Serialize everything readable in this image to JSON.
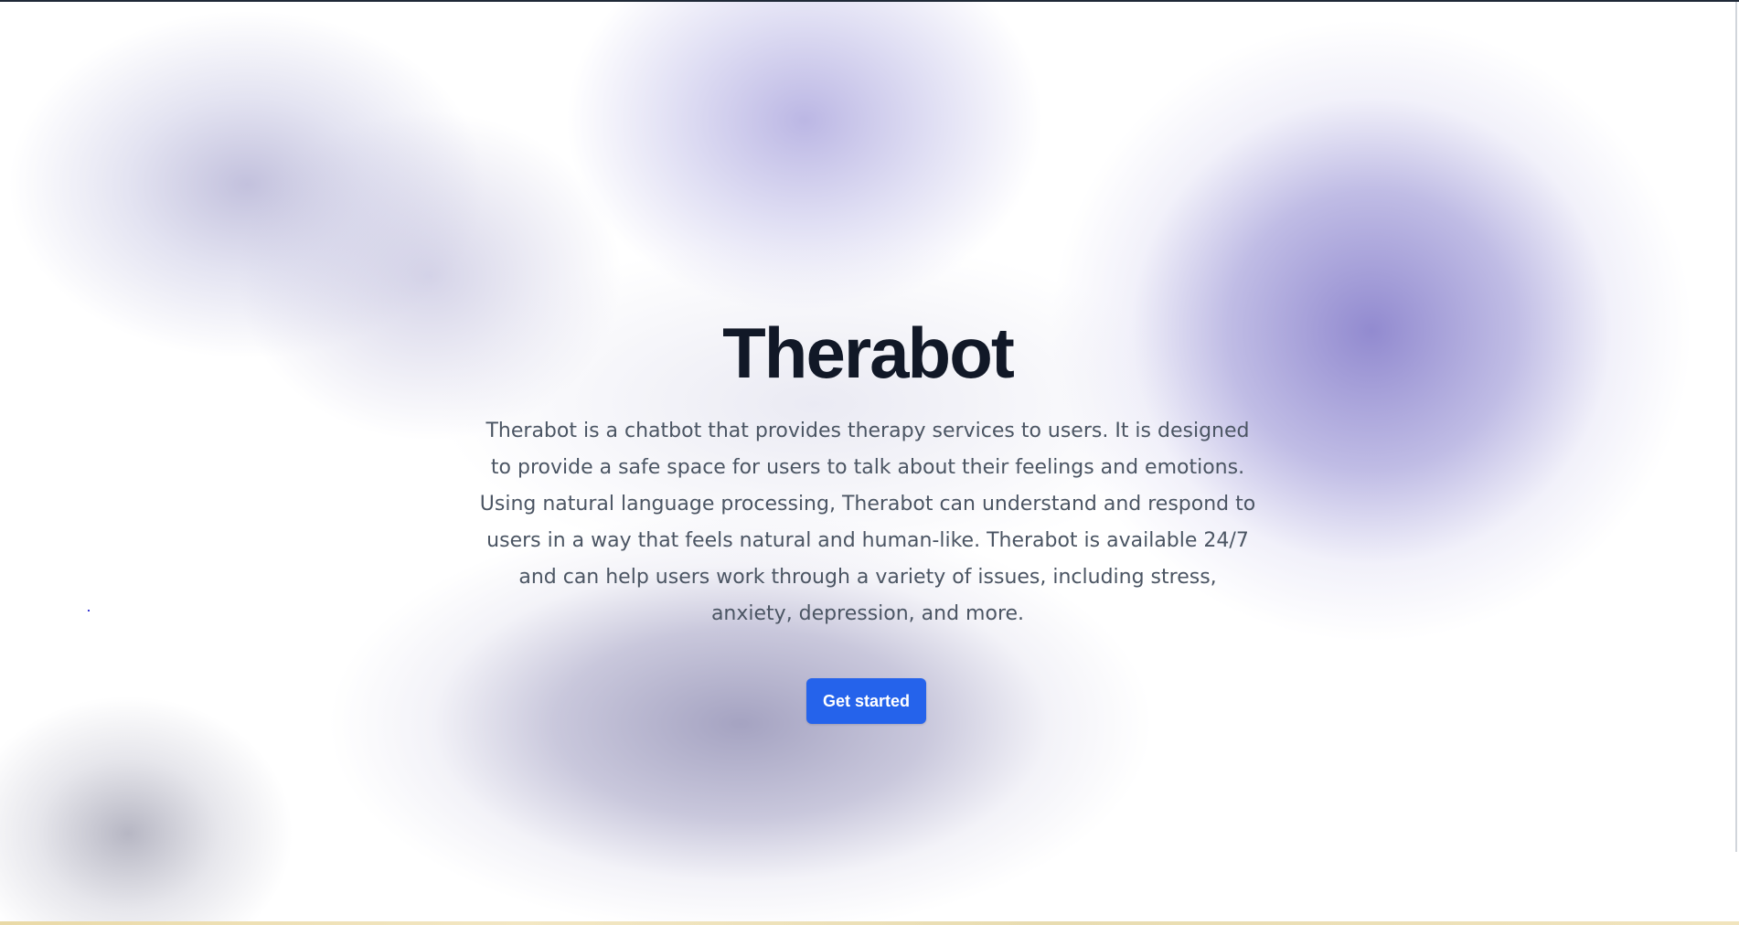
{
  "hero": {
    "title": "Therabot",
    "description": "Therabot is a chatbot that provides therapy services to users. It is designed to provide a safe space for users to talk about their feelings and emotions. Using natural language processing, Therabot can understand and respond to users in a way that feels natural and human-like. Therabot is available 24/7 and can help users work through a variety of issues, including stress, anxiety, depression, and more.",
    "cta_label": "Get started"
  },
  "colors": {
    "title": "#111827",
    "description": "#4b5563",
    "cta_background": "#2563eb",
    "cta_text": "#ffffff",
    "accent_blob": "#9b94d4"
  }
}
